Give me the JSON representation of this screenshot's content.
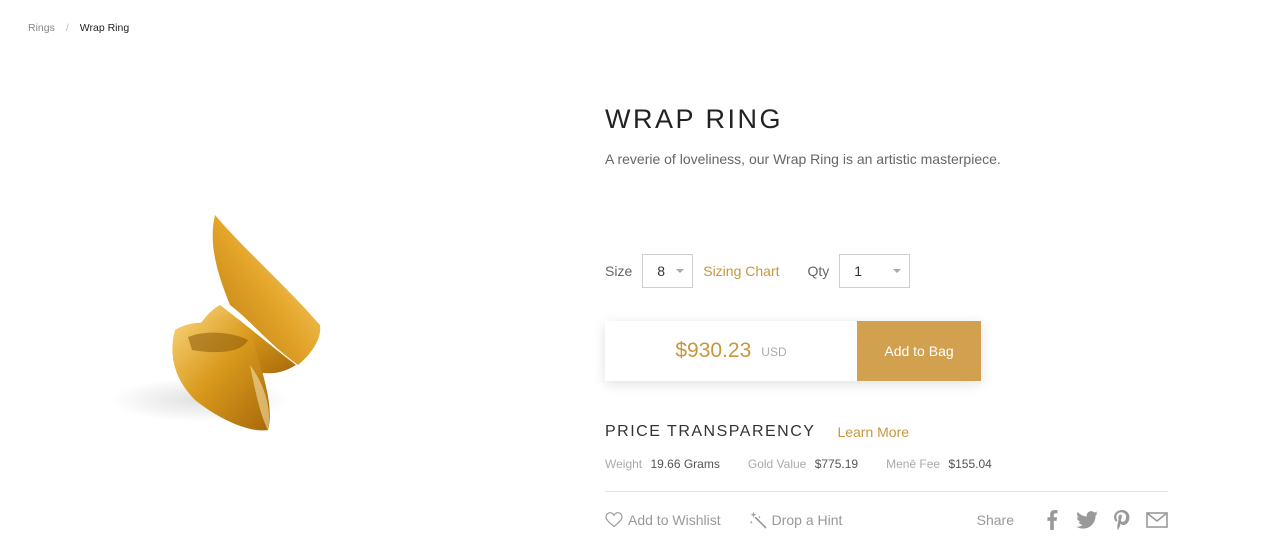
{
  "breadcrumb": {
    "parent": "Rings",
    "separator": "/",
    "current": "Wrap Ring"
  },
  "product": {
    "title": "WRAP RING",
    "description": "A reverie of loveliness, our Wrap Ring is an artistic masterpiece.",
    "image_icon": "gold-wrap-ring"
  },
  "options": {
    "size_label": "Size",
    "size_value": "8",
    "sizing_chart_label": "Sizing Chart",
    "qty_label": "Qty",
    "qty_value": "1"
  },
  "purchase": {
    "price": "$930.23",
    "currency": "USD",
    "add_to_bag_label": "Add to Bag"
  },
  "price_transparency": {
    "title": "PRICE TRANSPARENCY",
    "learn_more_label": "Learn More",
    "items": [
      {
        "label": "Weight",
        "value": "19.66 Grams"
      },
      {
        "label": "Gold Value",
        "value": "$775.19"
      },
      {
        "label": "Menē Fee",
        "value": "$155.04"
      }
    ]
  },
  "actions": {
    "wishlist_label": "Add to Wishlist",
    "hint_label": "Drop a Hint",
    "share_label": "Share",
    "share_icons": [
      "facebook-icon",
      "twitter-icon",
      "pinterest-icon",
      "email-icon"
    ]
  },
  "colors": {
    "accent": "#c9963c",
    "button": "#d1a14f",
    "text": "#333333",
    "muted": "#999999"
  }
}
